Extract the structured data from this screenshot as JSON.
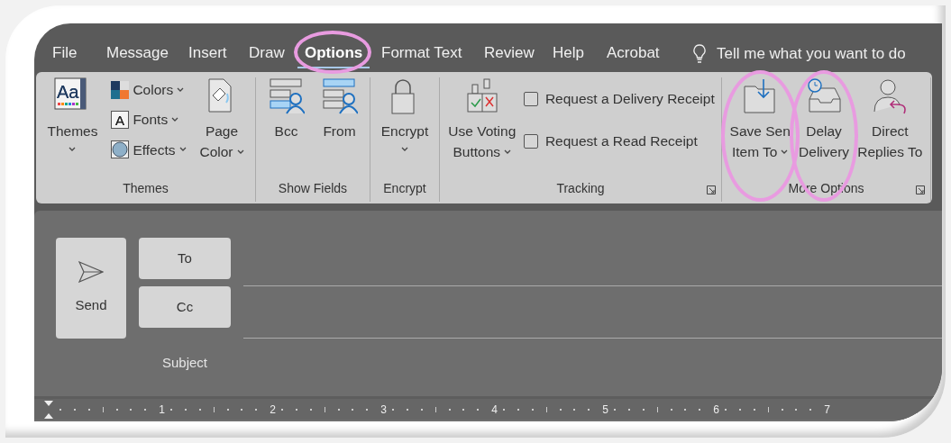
{
  "menu_tabs": [
    {
      "label": "File",
      "selected": false,
      "highlighted": false
    },
    {
      "label": "Message",
      "selected": false,
      "highlighted": false
    },
    {
      "label": "Insert",
      "selected": false,
      "highlighted": false
    },
    {
      "label": "Draw",
      "selected": false,
      "highlighted": false
    },
    {
      "label": "Options",
      "selected": true,
      "highlighted": true
    },
    {
      "label": "Format Text",
      "selected": false,
      "highlighted": false
    },
    {
      "label": "Review",
      "selected": false,
      "highlighted": false
    },
    {
      "label": "Help",
      "selected": false,
      "highlighted": false
    },
    {
      "label": "Acrobat",
      "selected": false,
      "highlighted": false
    }
  ],
  "tell_me": {
    "placeholder": "Tell me what you want to do"
  },
  "ribbon_groups": [
    {
      "label": "Themes",
      "launcher": false,
      "items": [
        {
          "kind": "large",
          "icon_text": "Aa",
          "lines": [
            "Themes"
          ],
          "dropdown": true,
          "highlighted": false
        },
        {
          "kind": "stack",
          "entries": [
            {
              "label": "Colors"
            },
            {
              "icon_text": "A",
              "label": "Fonts"
            },
            {
              "label": "Effects"
            }
          ]
        },
        {
          "kind": "large",
          "lines": [
            "Page",
            "Color"
          ],
          "dropdown": true,
          "highlighted": false
        }
      ]
    },
    {
      "label": "Show Fields",
      "launcher": false,
      "items": [
        {
          "kind": "large",
          "lines": [
            "Bcc"
          ],
          "dropdown": false,
          "highlighted": false
        },
        {
          "kind": "large",
          "lines": [
            "From"
          ],
          "dropdown": false,
          "highlighted": false
        }
      ]
    },
    {
      "label": "Encrypt",
      "launcher": false,
      "items": [
        {
          "kind": "large",
          "lines": [
            "Encrypt"
          ],
          "dropdown": true,
          "highlighted": false
        }
      ]
    },
    {
      "label": "Tracking",
      "launcher": true,
      "items": [
        {
          "kind": "large",
          "lines": [
            "Use Voting",
            "Buttons"
          ],
          "dropdown": true,
          "highlighted": false
        },
        {
          "kind": "checks",
          "entries": [
            {
              "label": "Request a Delivery Receipt",
              "checked": false
            },
            {
              "label": "Request a Read Receipt",
              "checked": false
            }
          ]
        }
      ]
    },
    {
      "label": "More Options",
      "launcher": true,
      "items": [
        {
          "kind": "large",
          "lines": [
            "Save Sen",
            "Item To"
          ],
          "dropdown": true,
          "highlighted": true
        },
        {
          "kind": "large",
          "lines": [
            "Delay",
            "Delivery"
          ],
          "dropdown": false,
          "highlighted": true
        },
        {
          "kind": "large",
          "lines": [
            "Direct",
            "Replies To"
          ],
          "dropdown": false,
          "highlighted": false
        }
      ]
    }
  ],
  "compose": {
    "send": "Send",
    "to": "To",
    "cc": "Cc",
    "subject": "Subject"
  },
  "ruler": [
    "1",
    "2",
    "3",
    "4",
    "5",
    "6",
    "7"
  ]
}
